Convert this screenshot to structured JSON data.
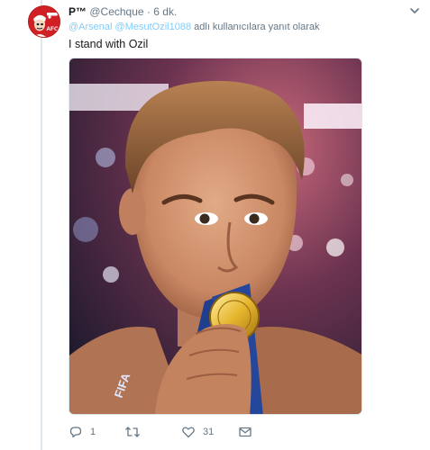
{
  "tweet": {
    "display_name": "P™",
    "handle": "@Cechque",
    "separator": "·",
    "time": "6 dk.",
    "reply_to": {
      "mention_1": "@Arsenal",
      "mention_2": "@MesutOzil1088",
      "suffix": "adlı kullanıcılara yanıt olarak"
    },
    "text": "I stand with Ozil",
    "avatar_badge": "AFC",
    "avatar_icon": "cannon-icon",
    "media_icon": "photo",
    "medal_lettering": "FIFA"
  },
  "actions": {
    "reply_count": "1",
    "retweet_count": "",
    "like_count": "31",
    "message_count": ""
  },
  "colors": {
    "accent": "#1da1f2",
    "avatar_red": "#d11f26",
    "muted": "#657786"
  }
}
